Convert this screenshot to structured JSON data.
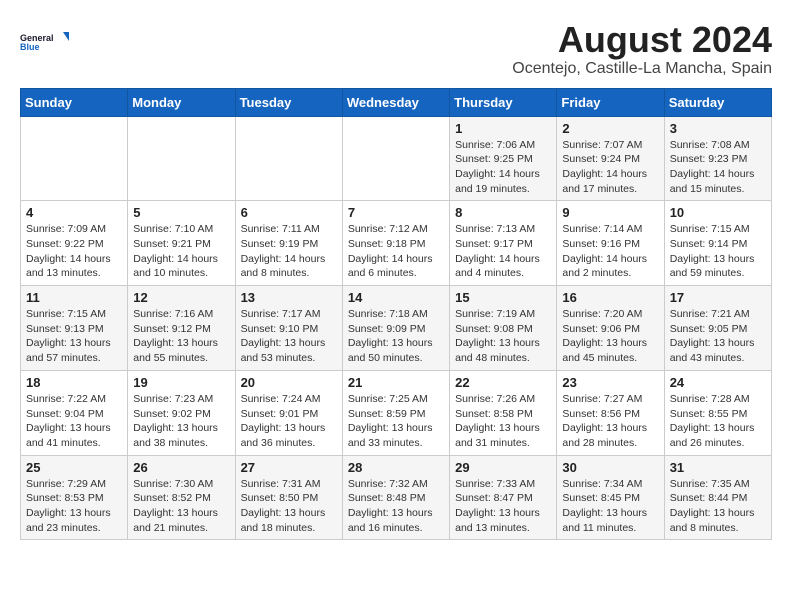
{
  "header": {
    "logo_general": "General",
    "logo_blue": "Blue",
    "month": "August 2024",
    "location": "Ocentejo, Castille-La Mancha, Spain"
  },
  "weekdays": [
    "Sunday",
    "Monday",
    "Tuesday",
    "Wednesday",
    "Thursday",
    "Friday",
    "Saturday"
  ],
  "weeks": [
    [
      {
        "day": "",
        "info": ""
      },
      {
        "day": "",
        "info": ""
      },
      {
        "day": "",
        "info": ""
      },
      {
        "day": "",
        "info": ""
      },
      {
        "day": "1",
        "info": "Sunrise: 7:06 AM\nSunset: 9:25 PM\nDaylight: 14 hours\nand 19 minutes."
      },
      {
        "day": "2",
        "info": "Sunrise: 7:07 AM\nSunset: 9:24 PM\nDaylight: 14 hours\nand 17 minutes."
      },
      {
        "day": "3",
        "info": "Sunrise: 7:08 AM\nSunset: 9:23 PM\nDaylight: 14 hours\nand 15 minutes."
      }
    ],
    [
      {
        "day": "4",
        "info": "Sunrise: 7:09 AM\nSunset: 9:22 PM\nDaylight: 14 hours\nand 13 minutes."
      },
      {
        "day": "5",
        "info": "Sunrise: 7:10 AM\nSunset: 9:21 PM\nDaylight: 14 hours\nand 10 minutes."
      },
      {
        "day": "6",
        "info": "Sunrise: 7:11 AM\nSunset: 9:19 PM\nDaylight: 14 hours\nand 8 minutes."
      },
      {
        "day": "7",
        "info": "Sunrise: 7:12 AM\nSunset: 9:18 PM\nDaylight: 14 hours\nand 6 minutes."
      },
      {
        "day": "8",
        "info": "Sunrise: 7:13 AM\nSunset: 9:17 PM\nDaylight: 14 hours\nand 4 minutes."
      },
      {
        "day": "9",
        "info": "Sunrise: 7:14 AM\nSunset: 9:16 PM\nDaylight: 14 hours\nand 2 minutes."
      },
      {
        "day": "10",
        "info": "Sunrise: 7:15 AM\nSunset: 9:14 PM\nDaylight: 13 hours\nand 59 minutes."
      }
    ],
    [
      {
        "day": "11",
        "info": "Sunrise: 7:15 AM\nSunset: 9:13 PM\nDaylight: 13 hours\nand 57 minutes."
      },
      {
        "day": "12",
        "info": "Sunrise: 7:16 AM\nSunset: 9:12 PM\nDaylight: 13 hours\nand 55 minutes."
      },
      {
        "day": "13",
        "info": "Sunrise: 7:17 AM\nSunset: 9:10 PM\nDaylight: 13 hours\nand 53 minutes."
      },
      {
        "day": "14",
        "info": "Sunrise: 7:18 AM\nSunset: 9:09 PM\nDaylight: 13 hours\nand 50 minutes."
      },
      {
        "day": "15",
        "info": "Sunrise: 7:19 AM\nSunset: 9:08 PM\nDaylight: 13 hours\nand 48 minutes."
      },
      {
        "day": "16",
        "info": "Sunrise: 7:20 AM\nSunset: 9:06 PM\nDaylight: 13 hours\nand 45 minutes."
      },
      {
        "day": "17",
        "info": "Sunrise: 7:21 AM\nSunset: 9:05 PM\nDaylight: 13 hours\nand 43 minutes."
      }
    ],
    [
      {
        "day": "18",
        "info": "Sunrise: 7:22 AM\nSunset: 9:04 PM\nDaylight: 13 hours\nand 41 minutes."
      },
      {
        "day": "19",
        "info": "Sunrise: 7:23 AM\nSunset: 9:02 PM\nDaylight: 13 hours\nand 38 minutes."
      },
      {
        "day": "20",
        "info": "Sunrise: 7:24 AM\nSunset: 9:01 PM\nDaylight: 13 hours\nand 36 minutes."
      },
      {
        "day": "21",
        "info": "Sunrise: 7:25 AM\nSunset: 8:59 PM\nDaylight: 13 hours\nand 33 minutes."
      },
      {
        "day": "22",
        "info": "Sunrise: 7:26 AM\nSunset: 8:58 PM\nDaylight: 13 hours\nand 31 minutes."
      },
      {
        "day": "23",
        "info": "Sunrise: 7:27 AM\nSunset: 8:56 PM\nDaylight: 13 hours\nand 28 minutes."
      },
      {
        "day": "24",
        "info": "Sunrise: 7:28 AM\nSunset: 8:55 PM\nDaylight: 13 hours\nand 26 minutes."
      }
    ],
    [
      {
        "day": "25",
        "info": "Sunrise: 7:29 AM\nSunset: 8:53 PM\nDaylight: 13 hours\nand 23 minutes."
      },
      {
        "day": "26",
        "info": "Sunrise: 7:30 AM\nSunset: 8:52 PM\nDaylight: 13 hours\nand 21 minutes."
      },
      {
        "day": "27",
        "info": "Sunrise: 7:31 AM\nSunset: 8:50 PM\nDaylight: 13 hours\nand 18 minutes."
      },
      {
        "day": "28",
        "info": "Sunrise: 7:32 AM\nSunset: 8:48 PM\nDaylight: 13 hours\nand 16 minutes."
      },
      {
        "day": "29",
        "info": "Sunrise: 7:33 AM\nSunset: 8:47 PM\nDaylight: 13 hours\nand 13 minutes."
      },
      {
        "day": "30",
        "info": "Sunrise: 7:34 AM\nSunset: 8:45 PM\nDaylight: 13 hours\nand 11 minutes."
      },
      {
        "day": "31",
        "info": "Sunrise: 7:35 AM\nSunset: 8:44 PM\nDaylight: 13 hours\nand 8 minutes."
      }
    ]
  ]
}
